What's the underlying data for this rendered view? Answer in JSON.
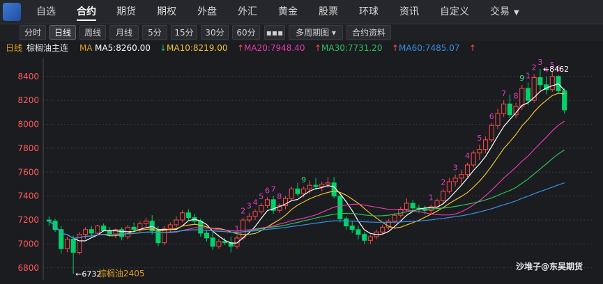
{
  "nav": {
    "items": [
      "自选",
      "合约",
      "期货",
      "期权",
      "外盘",
      "外汇",
      "黄金",
      "股票",
      "环球",
      "资讯",
      "自定义",
      "交易"
    ],
    "active": "合约"
  },
  "toolbar": {
    "expand": "》",
    "buttons": [
      "分时",
      "日线",
      "周线",
      "月线",
      "5分",
      "15分",
      "30分",
      "60分",
      "▪▪▪",
      "多周期图 ▾",
      "合约资料"
    ],
    "active": "日线"
  },
  "info": {
    "period": "日线",
    "name": "棕榈油主连",
    "ma_label": "MA",
    "ma5": "MA5:8260.00",
    "ma10": "MA10:8219.00",
    "ma20": "MA20:7948.40",
    "ma30": "MA30:7731.20",
    "ma60": "MA60:7485.07",
    "arrow_down": "↓",
    "arrow_up": "↑"
  },
  "colors": {
    "up": "#ff4a4a",
    "down": "#00d26a",
    "ma5": "#ffffff",
    "ma10": "#f2c230",
    "ma20": "#e83aa8",
    "ma30": "#2bc45a",
    "ma60": "#3a8fe6",
    "axis_text": "#ff5a5a",
    "grid": "#3a3b40",
    "seq_magenta": "#e040c0",
    "seq_green": "#3ce080"
  },
  "watermark": "沙堆子@东吴期货",
  "contract_label": "棕榈油2405",
  "chart_data": {
    "type": "candlestick",
    "ylim": [
      6700,
      8550
    ],
    "y_ticks": [
      6800,
      7000,
      7200,
      7400,
      7600,
      7800,
      8000,
      8200,
      8400
    ],
    "high_marker": "←8462",
    "low_marker": "←6732",
    "candles": [
      [
        7200,
        7230,
        7150,
        7190
      ],
      [
        7190,
        7210,
        7100,
        7120
      ],
      [
        7120,
        7150,
        6920,
        6960
      ],
      [
        6960,
        7060,
        6930,
        7040
      ],
      [
        7040,
        7070,
        6750,
        6930
      ],
      [
        6930,
        7100,
        6910,
        7080
      ],
      [
        7080,
        7140,
        7040,
        7120
      ],
      [
        7120,
        7150,
        7060,
        7090
      ],
      [
        7090,
        7160,
        7070,
        7150
      ],
      [
        7150,
        7170,
        7100,
        7110
      ],
      [
        7110,
        7140,
        7060,
        7080
      ],
      [
        7080,
        7130,
        7050,
        7120
      ],
      [
        7120,
        7140,
        7030,
        7060
      ],
      [
        7060,
        7160,
        7040,
        7140
      ],
      [
        7140,
        7180,
        7100,
        7120
      ],
      [
        7120,
        7190,
        7100,
        7170
      ],
      [
        7170,
        7220,
        7140,
        7190
      ],
      [
        7190,
        7240,
        7080,
        7110
      ],
      [
        7110,
        7150,
        6980,
        7010
      ],
      [
        7010,
        7150,
        6990,
        7130
      ],
      [
        7130,
        7180,
        7090,
        7160
      ],
      [
        7160,
        7230,
        7140,
        7200
      ],
      [
        7200,
        7280,
        7180,
        7260
      ],
      [
        7260,
        7290,
        7200,
        7220
      ],
      [
        7220,
        7250,
        7160,
        7190
      ],
      [
        7190,
        7210,
        7060,
        7090
      ],
      [
        7090,
        7120,
        7020,
        7050
      ],
      [
        7050,
        7100,
        6950,
        6980
      ],
      [
        6980,
        7040,
        6960,
        7020
      ],
      [
        7020,
        7050,
        6990,
        7010
      ],
      [
        7010,
        7060,
        6930,
        6980
      ],
      [
        6980,
        7070,
        6960,
        7050
      ],
      [
        7050,
        7220,
        7030,
        7200
      ],
      [
        7200,
        7260,
        7180,
        7230
      ],
      [
        7230,
        7290,
        7200,
        7270
      ],
      [
        7270,
        7340,
        7250,
        7320
      ],
      [
        7320,
        7390,
        7300,
        7370
      ],
      [
        7370,
        7400,
        7250,
        7280
      ],
      [
        7280,
        7340,
        7260,
        7320
      ],
      [
        7320,
        7400,
        7290,
        7380
      ],
      [
        7380,
        7480,
        7360,
        7460
      ],
      [
        7460,
        7510,
        7400,
        7420
      ],
      [
        7420,
        7480,
        7390,
        7460
      ],
      [
        7460,
        7530,
        7420,
        7490
      ],
      [
        7490,
        7550,
        7450,
        7480
      ],
      [
        7480,
        7520,
        7440,
        7500
      ],
      [
        7500,
        7560,
        7470,
        7510
      ],
      [
        7510,
        7560,
        7380,
        7400
      ],
      [
        7400,
        7420,
        7180,
        7210
      ],
      [
        7210,
        7230,
        7120,
        7150
      ],
      [
        7150,
        7190,
        7090,
        7120
      ],
      [
        7120,
        7150,
        7040,
        7080
      ],
      [
        7080,
        7100,
        7000,
        7030
      ],
      [
        7030,
        7080,
        7000,
        7060
      ],
      [
        7060,
        7120,
        7040,
        7100
      ],
      [
        7100,
        7160,
        7080,
        7140
      ],
      [
        7140,
        7210,
        7120,
        7190
      ],
      [
        7190,
        7260,
        7170,
        7240
      ],
      [
        7240,
        7310,
        7220,
        7290
      ],
      [
        7290,
        7380,
        7270,
        7340
      ],
      [
        7340,
        7370,
        7280,
        7300
      ],
      [
        7300,
        7330,
        7260,
        7290
      ],
      [
        7290,
        7320,
        7250,
        7280
      ],
      [
        7280,
        7330,
        7250,
        7310
      ],
      [
        7310,
        7380,
        7290,
        7360
      ],
      [
        7360,
        7460,
        7340,
        7440
      ],
      [
        7440,
        7550,
        7420,
        7520
      ],
      [
        7520,
        7580,
        7480,
        7550
      ],
      [
        7550,
        7620,
        7500,
        7580
      ],
      [
        7580,
        7680,
        7560,
        7660
      ],
      [
        7660,
        7780,
        7640,
        7760
      ],
      [
        7760,
        7830,
        7700,
        7790
      ],
      [
        7790,
        7900,
        7760,
        7870
      ],
      [
        7870,
        8010,
        7850,
        7990
      ],
      [
        7990,
        8130,
        7960,
        8090
      ],
      [
        8090,
        8200,
        8060,
        8170
      ],
      [
        8170,
        8250,
        8050,
        8080
      ],
      [
        8080,
        8180,
        8050,
        8150
      ],
      [
        8150,
        8330,
        8120,
        8300
      ],
      [
        8300,
        8350,
        8160,
        8200
      ],
      [
        8200,
        8420,
        8180,
        8390
      ],
      [
        8390,
        8462,
        8280,
        8330
      ],
      [
        8330,
        8400,
        8250,
        8290
      ],
      [
        8290,
        8440,
        8270,
        8400
      ],
      [
        8400,
        8410,
        8260,
        8280
      ],
      [
        8280,
        8300,
        8090,
        8120
      ]
    ],
    "seq_labels": [
      {
        "i": 31,
        "t": "1",
        "c": "magenta"
      },
      {
        "i": 32,
        "t": "2",
        "c": "magenta"
      },
      {
        "i": 33,
        "t": "3",
        "c": "magenta"
      },
      {
        "i": 34,
        "t": "4",
        "c": "magenta"
      },
      {
        "i": 35,
        "t": "5",
        "c": "magenta"
      },
      {
        "i": 36,
        "t": "6",
        "c": "magenta"
      },
      {
        "i": 37,
        "t": "7",
        "c": "magenta"
      },
      {
        "i": 38,
        "t": "8",
        "c": "magenta"
      },
      {
        "i": 42,
        "t": "9",
        "c": "green"
      },
      {
        "i": 63,
        "t": "1",
        "c": "magenta"
      },
      {
        "i": 65,
        "t": "2",
        "c": "magenta"
      },
      {
        "i": 67,
        "t": "3",
        "c": "magenta"
      },
      {
        "i": 69,
        "t": "4",
        "c": "magenta"
      },
      {
        "i": 71,
        "t": "5",
        "c": "magenta"
      },
      {
        "i": 73,
        "t": "6",
        "c": "magenta"
      },
      {
        "i": 75,
        "t": "7",
        "c": "magenta"
      },
      {
        "i": 77,
        "t": "8",
        "c": "magenta"
      },
      {
        "i": 78,
        "t": "9",
        "c": "green"
      },
      {
        "i": 79,
        "t": "1",
        "c": "magenta"
      },
      {
        "i": 80,
        "t": "2",
        "c": "magenta"
      },
      {
        "i": 81,
        "t": "3",
        "c": "magenta"
      },
      {
        "i": 82,
        "t": "4",
        "c": "magenta"
      },
      {
        "i": 83,
        "t": "5",
        "c": "magenta"
      },
      {
        "i": 84,
        "t": "6",
        "c": "magenta"
      }
    ],
    "ma_series": [
      {
        "name": "MA5",
        "period": 5,
        "color": "#ffffff"
      },
      {
        "name": "MA10",
        "period": 10,
        "color": "#f2c230"
      },
      {
        "name": "MA20",
        "period": 20,
        "color": "#e83aa8"
      },
      {
        "name": "MA30",
        "period": 30,
        "color": "#2bc45a"
      },
      {
        "name": "MA60",
        "period": 60,
        "color": "#3a8fe6"
      }
    ]
  }
}
